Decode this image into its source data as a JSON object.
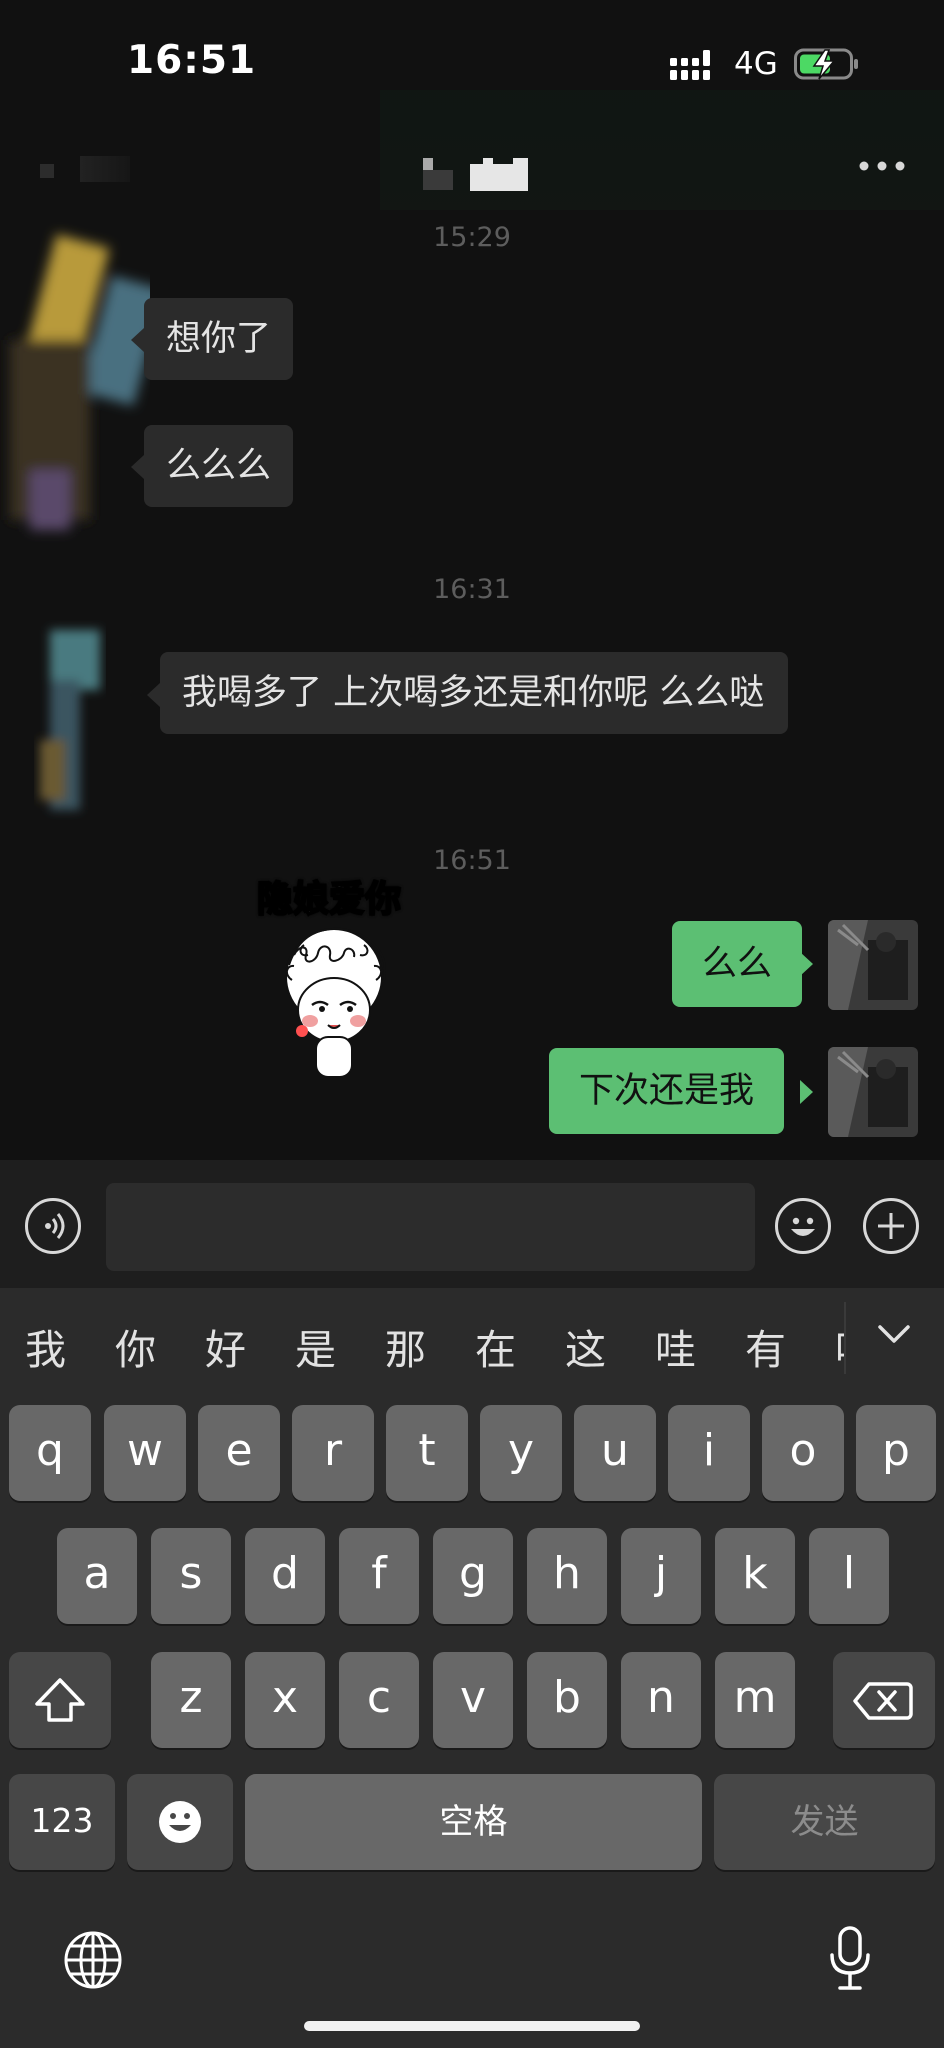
{
  "status_bar": {
    "time": "16:51",
    "network": "4G"
  },
  "header": {
    "more_icon": "ellipsis-icon"
  },
  "messages": [
    {
      "type": "timestamp",
      "text": "15:29"
    },
    {
      "type": "incoming",
      "text": "想你了"
    },
    {
      "type": "incoming",
      "text": "么么么"
    },
    {
      "type": "timestamp",
      "text": "16:31"
    },
    {
      "type": "incoming",
      "text": "我喝多了 上次喝多还是和你呢 么么哒"
    },
    {
      "type": "timestamp",
      "text": "16:51"
    },
    {
      "type": "incoming_sticker",
      "caption": "隐娘爱你"
    },
    {
      "type": "outgoing",
      "text": "么么"
    },
    {
      "type": "outgoing",
      "text": "下次还是我"
    }
  ],
  "input": {
    "value": "",
    "placeholder": ""
  },
  "keyboard": {
    "candidates": [
      "我",
      "你",
      "好",
      "是",
      "那",
      "在",
      "这",
      "哇",
      "有",
      "吗"
    ],
    "row1": [
      "q",
      "w",
      "e",
      "r",
      "t",
      "y",
      "u",
      "i",
      "o",
      "p"
    ],
    "row2": [
      "a",
      "s",
      "d",
      "f",
      "g",
      "h",
      "j",
      "k",
      "l"
    ],
    "row3": [
      "z",
      "x",
      "c",
      "v",
      "b",
      "n",
      "m"
    ],
    "numbers_label": "123",
    "space_label": "空格",
    "send_label": "发送"
  },
  "colors": {
    "outgoing_bubble": "#5cbf73",
    "incoming_bubble": "#2b2b2b",
    "background": "#111111"
  }
}
